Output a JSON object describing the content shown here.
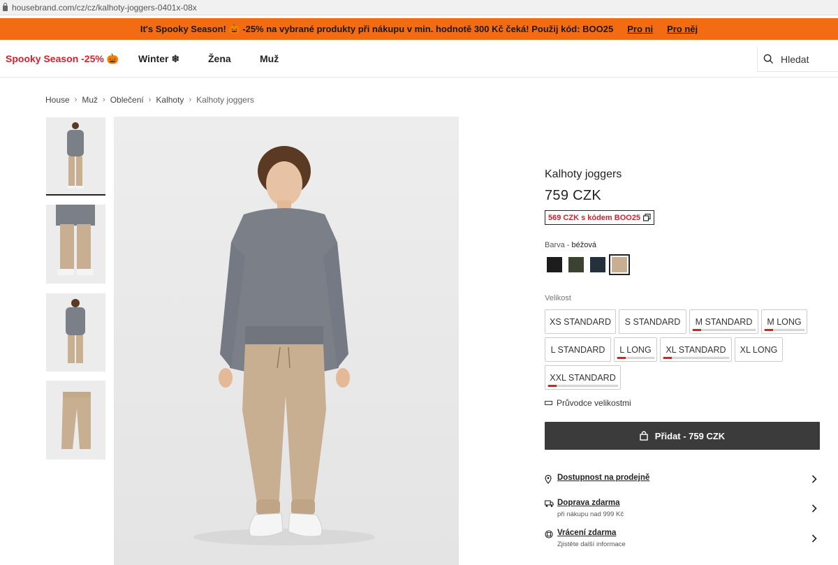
{
  "browser": {
    "url": "housebrand.com/cz/cz/kalhoty-joggers-0401x-08x"
  },
  "promo": {
    "text": "It's Spooky Season! 🎃 -25% na vybrané produkty při nákupu v min. hodnotě 300 Kč čeká! Použij kód: BOO25",
    "link_her": "Pro ni",
    "link_him": "Pro něj"
  },
  "nav": {
    "spooky": "Spooky Season -25% 🎃",
    "winter": "Winter ❄",
    "women": "Žena",
    "men": "Muž",
    "search": "Hledat"
  },
  "breadcrumb": [
    "House",
    "Muž",
    "Oblečení",
    "Kalhoty",
    "Kalhoty joggers"
  ],
  "product": {
    "title": "Kalhoty joggers",
    "price": "759 CZK",
    "promo_price": "569 CZK s kódem BOO25",
    "color_label": "Barva",
    "color_name": "béžová",
    "colors": [
      {
        "name": "black",
        "hex": "#1c1c1c"
      },
      {
        "name": "olive",
        "hex": "#3b4231"
      },
      {
        "name": "navy",
        "hex": "#24303b"
      },
      {
        "name": "beige",
        "hex": "#c9af92",
        "selected": true
      }
    ],
    "size_label": "Velikost",
    "sizes": [
      {
        "label": "XS STANDARD",
        "low_stock": false
      },
      {
        "label": "S STANDARD",
        "low_stock": false
      },
      {
        "label": "M STANDARD",
        "low_stock": true
      },
      {
        "label": "M LONG",
        "low_stock": true
      },
      {
        "label": "L STANDARD",
        "low_stock": false
      },
      {
        "label": "L LONG",
        "low_stock": true
      },
      {
        "label": "XL STANDARD",
        "low_stock": true
      },
      {
        "label": "XL LONG",
        "low_stock": false
      },
      {
        "label": "XXL STANDARD",
        "low_stock": true
      }
    ],
    "size_guide": "Průvodce velikostmi",
    "add_button": "Přidat - 759 CZK"
  },
  "info": [
    {
      "title": "Dostupnost na prodejně",
      "sub": "",
      "icon": "location-pin-icon"
    },
    {
      "title": "Doprava zdarma",
      "sub": "při nákupu nad 999 Kč",
      "icon": "truck-icon"
    },
    {
      "title": "Vrácení zdarma",
      "sub": "Zjistěte další informace",
      "icon": "return-icon"
    }
  ],
  "colors": {
    "promo_bg": "#f36b12",
    "accent_red": "#d2232a",
    "button_dark": "#3b3b3b"
  }
}
